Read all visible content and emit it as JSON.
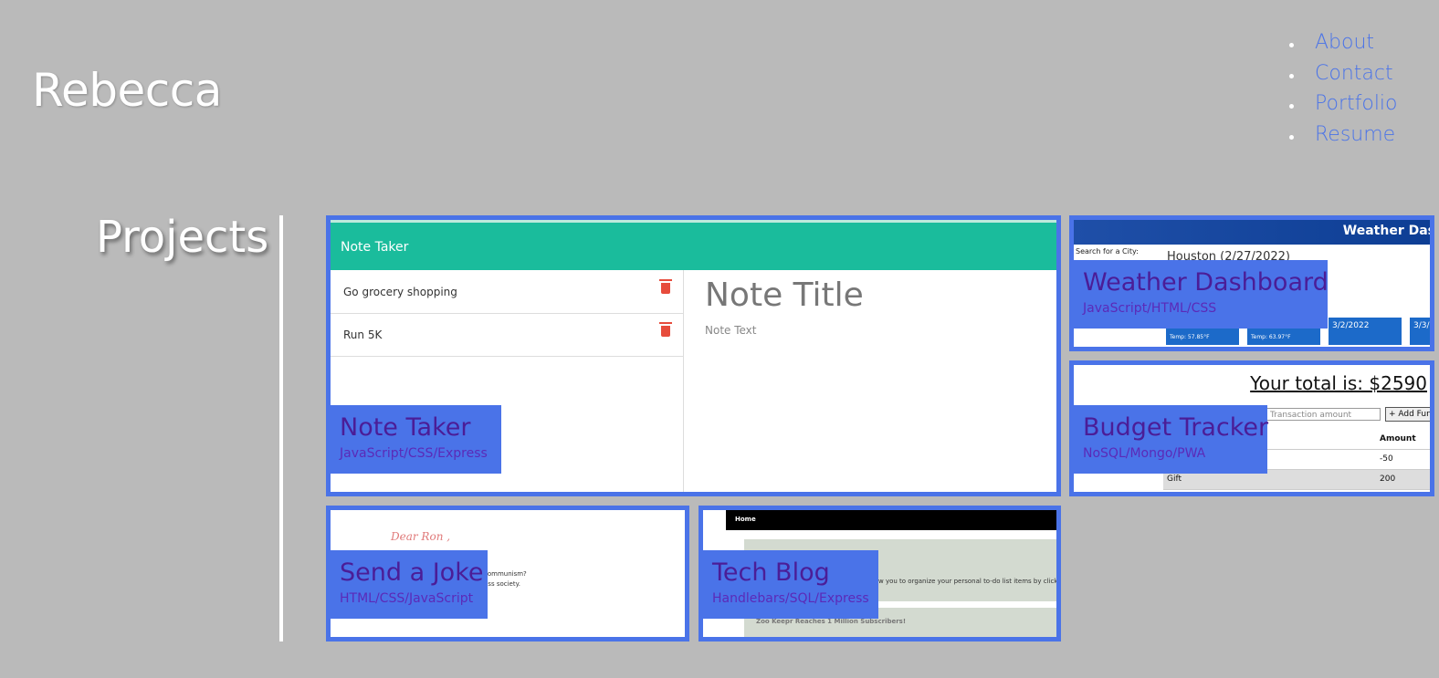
{
  "brand": "Rebecca",
  "nav": [
    "About",
    "Contact",
    "Portfolio",
    "Resume"
  ],
  "section_title": "Projects",
  "projects": {
    "note_taker": {
      "title": "Note Taker",
      "tech": "JavaScript/CSS/Express",
      "screenshot": {
        "header": "Note Taker",
        "notes": [
          "Go grocery shopping",
          "Run 5K"
        ],
        "note_title": "Note Title",
        "note_text": "Note Text"
      }
    },
    "weather_dashboard": {
      "title": "Weather Dashboard",
      "tech": "JavaScript/HTML/CSS",
      "screenshot": {
        "header": "Weather Dashboard",
        "search_label": "Search for a City:",
        "city": "Houston (2/27/2022)",
        "forecast": [
          "Temp: 57.85°F",
          "Temp: 63.97°F",
          "3/2/2022",
          "3/3/"
        ]
      }
    },
    "budget_tracker": {
      "title": "Budget Tracker",
      "tech": "NoSQL/Mongo/PWA",
      "screenshot": {
        "total": "Your total is: $2590",
        "amount_placeholder": "Transaction amount",
        "add_button": "+ Add Fun",
        "col_amount": "Amount",
        "rows": [
          {
            "name": "",
            "amount": "-50"
          },
          {
            "name": "Gift",
            "amount": "200"
          }
        ]
      }
    },
    "send_a_joke": {
      "title": "Send a Joke",
      "tech": "HTML/CSS/JavaScript",
      "screenshot": {
        "greeting": "Dear Ron ,",
        "line1": "communism?",
        "line2": "ess society."
      }
    },
    "tech_blog": {
      "title": "Tech Blog",
      "tech": "Handlebars/SQL/Express",
      "screenshot": {
        "nav_home": "Home",
        "line1": "w you to organize your personal to-do list items by clicking an",
        "line2": "Zoo Keepr Reaches 1 Million Subscribers!"
      }
    }
  },
  "colors": {
    "background": "#bababa",
    "accent": "#4a73e8",
    "project_title": "#4b1d97",
    "note_header": "#1abc9c"
  }
}
